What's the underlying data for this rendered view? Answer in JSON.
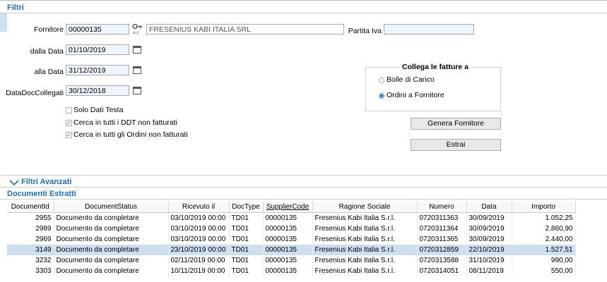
{
  "filters": {
    "title": "Filtri",
    "fornitore": {
      "label": "Fornitore",
      "code": "00000135",
      "name": "FRESENIUS KABI ITALIA SRL"
    },
    "partita_iva": {
      "label": "Partita Iva",
      "value": ""
    },
    "dalla_data": {
      "label": "dalla Data",
      "value": "01/10/2019"
    },
    "alla_data": {
      "label": "alla Data",
      "value": "31/12/2019"
    },
    "data_doc_collegati": {
      "label": "DataDocCollegati",
      "value": "30/12/2018"
    },
    "checkboxes": [
      {
        "label": "Solo Dati Testa",
        "checked": false
      },
      {
        "label": "Cerca in tutti i DDT non fatturati",
        "checked": true
      },
      {
        "label": "Cerca in tutti gli Ordini non fatturati",
        "checked": true
      }
    ],
    "collega": {
      "title": "Collega le fatture a",
      "options": [
        {
          "label": "Bolle di Carico",
          "selected": false
        },
        {
          "label": "Ordini a Fornitore",
          "selected": true
        }
      ]
    },
    "genera_label": "Genera Fornitore",
    "estrai_label": "Estrai",
    "key_icon_sub": "a-z"
  },
  "advanced": {
    "title": "Filtri Avanzati"
  },
  "documents": {
    "title": "Documenti Estratti",
    "columns": [
      "DocumentId",
      "DocumentStatus",
      "Ricevuto il",
      "DocType",
      "SupplierCode",
      "Ragione Sociale",
      "Numero",
      "Data",
      "Importo"
    ],
    "rows": [
      [
        "2955",
        "Documento da completare",
        "03/10/2019 00:00",
        "TD01",
        "00000135",
        "Fresenius Kabi Italia S.r.l.",
        "0720311363",
        "30/09/2019",
        "1.052,25"
      ],
      [
        "2989",
        "Documento da completare",
        "03/10/2019 00:00",
        "TD01",
        "00000135",
        "Fresenius Kabi Italia S.r.l.",
        "0720311364",
        "30/09/2019",
        "2.860,90"
      ],
      [
        "2969",
        "Documento da completare",
        "03/10/2019 00:00",
        "TD01",
        "00000135",
        "Fresenius Kabi Italia S.r.l.",
        "0720311365",
        "30/09/2019",
        "2.440,00"
      ],
      [
        "3149",
        "Documento da completare",
        "23/10/2019 00:00",
        "TD01",
        "00000135",
        "Fresenius Kabi Italia S.r.l.",
        "0720312859",
        "22/10/2019",
        "1.527,51"
      ],
      [
        "3232",
        "Documento da completare",
        "02/11/2019 00:00",
        "TD01",
        "00000135",
        "Fresenius Kabi Italia S.r.l.",
        "0720313588",
        "31/10/2019",
        "990,00"
      ],
      [
        "3303",
        "Documento da completare",
        "10/11/2019 00:00",
        "TD01",
        "00000135",
        "Fresenius Kabi Italia S.r.l.",
        "0720314051",
        "08/11/2019",
        "550,00"
      ]
    ],
    "selected_index": 3
  }
}
